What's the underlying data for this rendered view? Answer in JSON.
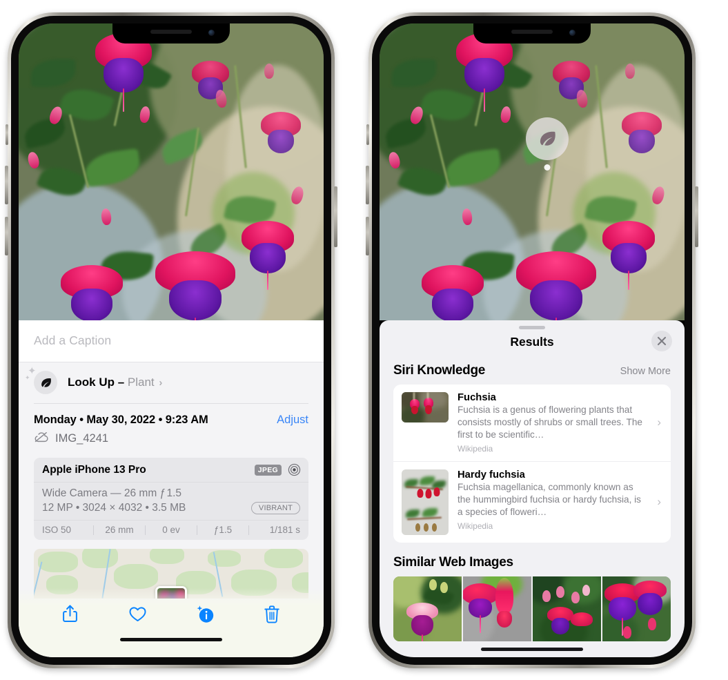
{
  "left_phone": {
    "caption": {
      "placeholder": "Add a Caption",
      "value": ""
    },
    "lookup": {
      "label": "Look Up –",
      "subject": "Plant",
      "icon": "leaf-icon",
      "chevron": "›"
    },
    "info": {
      "date": "Monday • May 30, 2022 • 9:23 AM",
      "adjust_label": "Adjust",
      "filename": "IMG_4241",
      "cloud_icon": "cloud-slash-icon"
    },
    "camera": {
      "model": "Apple iPhone 13 Pro",
      "format_badge": "JPEG",
      "lens_icon": "lens-icon",
      "lens": "Wide Camera — 26 mm ƒ 1.5",
      "specs": "12 MP • 3024 × 4032 • 3.5 MB",
      "style_badge": "VIBRANT",
      "exif": [
        "ISO 50",
        "26 mm",
        "0 ev",
        "ƒ1.5",
        "1/181 s"
      ]
    },
    "toolbar": [
      {
        "name": "share-icon",
        "glyph": "share"
      },
      {
        "name": "favorite-heart-icon",
        "glyph": "heart"
      },
      {
        "name": "info-icon",
        "glyph": "info"
      },
      {
        "name": "trash-icon",
        "glyph": "trash"
      }
    ]
  },
  "right_phone": {
    "visual_lookup_badge": {
      "icon": "leaf-icon"
    },
    "sheet": {
      "title": "Results",
      "close_icon": "close-icon"
    },
    "siri_knowledge": {
      "heading": "Siri Knowledge",
      "action": "Show More",
      "items": [
        {
          "title": "Fuchsia",
          "description": "Fuchsia is a genus of flowering plants that consists mostly of shrubs or small trees. The first to be scientific…",
          "source": "Wikipedia",
          "chevron": "›"
        },
        {
          "title": "Hardy fuchsia",
          "description": "Fuchsia magellanica, commonly known as the hummingbird fuchsia or hardy fuchsia, is a species of floweri…",
          "source": "Wikipedia",
          "chevron": "›"
        }
      ]
    },
    "similar_web_images": {
      "heading": "Similar Web Images",
      "count": 4
    }
  },
  "colors": {
    "accent_blue": "#3a86f7",
    "sheet_bg": "#f1f1f4",
    "card_bg": "#ffffff",
    "secondary_text": "#838389",
    "badge_gray": "#8e8e93"
  }
}
